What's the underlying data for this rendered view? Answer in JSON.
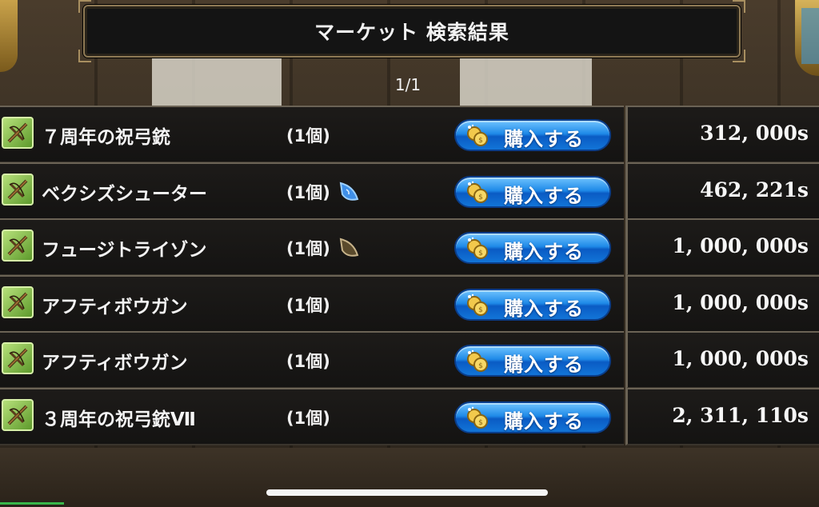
{
  "header": {
    "title": "マーケット 検索結果"
  },
  "pagination": {
    "indicator": "1/1"
  },
  "buy_button_label": "購入する",
  "items": [
    {
      "name": "７周年の祝弓銃",
      "qty": "(1個)",
      "gem": null,
      "price": "312, 000s"
    },
    {
      "name": "ベクシズシューター",
      "qty": "(1個)",
      "gem": "blue-gem",
      "price": "462, 221s"
    },
    {
      "name": "フュージトライゾン",
      "qty": "(1個)",
      "gem": "brown-gem",
      "price": "1, 000, 000s"
    },
    {
      "name": "アフティボウガン",
      "qty": "(1個)",
      "gem": null,
      "price": "1, 000, 000s"
    },
    {
      "name": "アフティボウガン",
      "qty": "(1個)",
      "gem": null,
      "price": "1, 000, 000s"
    },
    {
      "name": "３周年の祝弓銃Ⅶ",
      "qty": "(1個)",
      "gem": null,
      "price": "2, 311, 110s"
    }
  ],
  "colors": {
    "accent_button": "#1f8ae8",
    "item_icon_green": "#7cc046",
    "frame_gold": "#8f7a55"
  },
  "icons": {
    "item": "crossbow-icon",
    "coin": "coin-icon"
  }
}
